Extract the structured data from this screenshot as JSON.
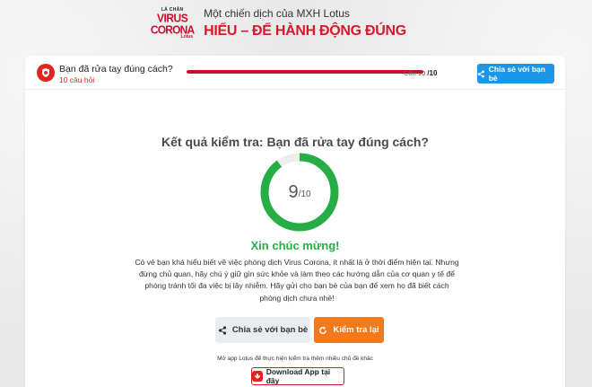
{
  "header": {
    "logo": {
      "line1": "LÁ CHẮN",
      "line2": "VIRUS",
      "line3": "CORONA",
      "line4": "Lotus"
    },
    "subtitle": "Một chiến dịch của MXH Lotus",
    "title": "HIỂU – ĐỂ HÀNH ĐỘNG ĐÚNG"
  },
  "quiz": {
    "title": "Bạn đã rửa tay đúng cách?",
    "count_label": "10 câu hỏi",
    "progress": {
      "prefix": "Câu",
      "current": "10",
      "total": "/10",
      "fraction": 1.0
    },
    "share_label": "Chia sẻ với bạn bè"
  },
  "result": {
    "title": "Kết quả kiểm tra: Bạn đã rửa tay đúng cách?",
    "score": "9",
    "score_total": "/10",
    "score_fraction": 0.9,
    "congrats": "Xin chúc mừng!",
    "description": "Có vẻ bạn khá hiểu biết về việc phòng dịch Virus Corona, ít nhất là ở thời điểm hiện tại. Nhưng đừng chủ quan, hãy chú ý giữ gìn sức khỏe và làm theo các hướng dẫn của cơ quan y tế để phòng tránh tối đa việc bị lây nhiễm. Hãy gửi cho bạn bè của bạn để xem họ đã biết cách phòng dịch chưa nhé!",
    "share_button": "Chia sẻ với bạn bè",
    "retry_button": "Kiểm tra lại",
    "note": "Mở app Lotus để thực hiện kiểm tra thêm nhiều chủ đề khác",
    "download_button": "Download App tại đây"
  },
  "colors": {
    "brand_red": "#d7192b",
    "progress_red": "#c8102e",
    "share_blue": "#1d96e8",
    "ring_green": "#27ad45",
    "retry_orange": "#f27a1a"
  },
  "icons": [
    "virus-shield-icon",
    "share-icon",
    "retry-icon",
    "lotus-app-icon"
  ]
}
